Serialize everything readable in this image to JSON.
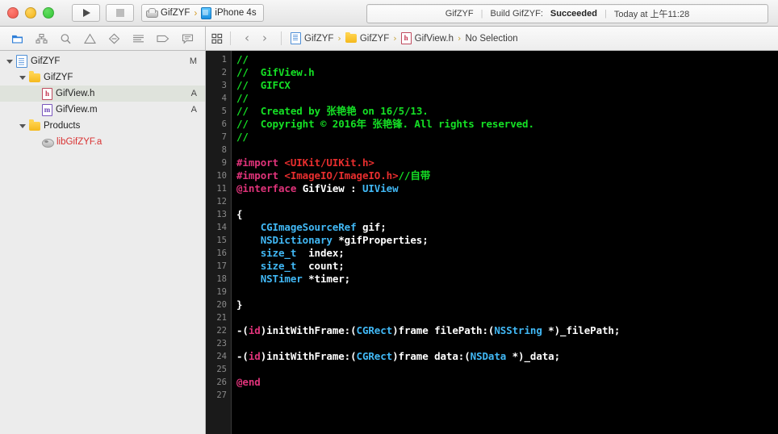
{
  "window": {
    "traffic_lights": [
      "close",
      "minimize",
      "zoom"
    ]
  },
  "toolbar": {
    "run_label": "Run",
    "stop_label": "Stop",
    "scheme": {
      "target": "GifZYF",
      "separator": "›",
      "destination": "iPhone 4s"
    },
    "status": {
      "project": "GifZYF",
      "pipe": "|",
      "action": "Build GifZYF:",
      "result": "Succeeded",
      "time": "Today at 上午11:28"
    }
  },
  "navigator_filter": {
    "icons": [
      {
        "name": "folder-icon",
        "label": "Project navigator",
        "active": true
      },
      {
        "name": "hierarchy-icon",
        "label": "Source control navigator",
        "active": false
      },
      {
        "name": "search-icon",
        "label": "Find navigator",
        "active": false
      },
      {
        "name": "warning-triangle-icon",
        "label": "Issue navigator",
        "active": false
      },
      {
        "name": "diamond-icon",
        "label": "Test navigator",
        "active": false
      },
      {
        "name": "list-lines-icon",
        "label": "Debug navigator",
        "active": false
      },
      {
        "name": "tag-icon",
        "label": "Breakpoint navigator",
        "active": false
      },
      {
        "name": "speech-bubble-icon",
        "label": "Report navigator",
        "active": false
      }
    ]
  },
  "breadcrumb": {
    "grid_icon": "grid-icon",
    "back": "‹",
    "forward": "›",
    "items": [
      {
        "label": "GifZYF",
        "icon": "project-doc-icon"
      },
      {
        "label": "GifZYF",
        "icon": "folder-icon"
      },
      {
        "label": "GifView.h",
        "icon": "header-file-icon"
      },
      {
        "label": "No Selection",
        "icon": null
      }
    ],
    "chevron": "›"
  },
  "sidebar": {
    "tree": [
      {
        "label": "GifZYF",
        "icon": "project-icon",
        "indent": 0,
        "disclosure": "open",
        "status": "M",
        "selected": false,
        "red": false
      },
      {
        "label": "GifZYF",
        "icon": "folder-icon",
        "indent": 1,
        "disclosure": "open",
        "status": "",
        "selected": false,
        "red": false
      },
      {
        "label": "GifView.h",
        "icon": "header-file-icon",
        "indent": 2,
        "disclosure": "none",
        "status": "A",
        "selected": true,
        "red": false
      },
      {
        "label": "GifView.m",
        "icon": "source-file-icon",
        "indent": 2,
        "disclosure": "none",
        "status": "A",
        "selected": false,
        "red": false
      },
      {
        "label": "Products",
        "icon": "folder-icon",
        "indent": 1,
        "disclosure": "open",
        "status": "",
        "selected": false,
        "red": false
      },
      {
        "label": "libGifZYF.a",
        "icon": "library-icon",
        "indent": 2,
        "disclosure": "none",
        "status": "",
        "selected": false,
        "red": true
      }
    ]
  },
  "editor": {
    "first_line": 1,
    "last_line": 27,
    "line_numbers": [
      1,
      2,
      3,
      4,
      5,
      6,
      7,
      8,
      9,
      10,
      11,
      12,
      13,
      14,
      15,
      16,
      17,
      18,
      19,
      20,
      21,
      22,
      23,
      24,
      25,
      26,
      27
    ],
    "lines": [
      {
        "n": 1,
        "tokens": [
          {
            "t": "//",
            "c": "cmt"
          }
        ]
      },
      {
        "n": 2,
        "tokens": [
          {
            "t": "//  GifView.h",
            "c": "cmt"
          }
        ]
      },
      {
        "n": 3,
        "tokens": [
          {
            "t": "//  GIFCX",
            "c": "cmt"
          }
        ]
      },
      {
        "n": 4,
        "tokens": [
          {
            "t": "//",
            "c": "cmt"
          }
        ]
      },
      {
        "n": 5,
        "tokens": [
          {
            "t": "//  Created by 张艳艳 on 16/5/13.",
            "c": "cmt"
          }
        ]
      },
      {
        "n": 6,
        "tokens": [
          {
            "t": "//  Copyright © 2016年 张艳锋. All rights reserved.",
            "c": "cmt"
          }
        ]
      },
      {
        "n": 7,
        "tokens": [
          {
            "t": "//",
            "c": "cmt"
          }
        ]
      },
      {
        "n": 8,
        "tokens": []
      },
      {
        "n": 9,
        "tokens": [
          {
            "t": "#import ",
            "c": "pre"
          },
          {
            "t": "<UIKit/UIKit.h>",
            "c": "str"
          }
        ]
      },
      {
        "n": 10,
        "tokens": [
          {
            "t": "#import ",
            "c": "pre"
          },
          {
            "t": "<ImageIO/ImageIO.h>",
            "c": "str"
          },
          {
            "t": "//自带",
            "c": "cmt"
          }
        ]
      },
      {
        "n": 11,
        "tokens": [
          {
            "t": "@interface",
            "c": "kw"
          },
          {
            "t": " GifView : ",
            "c": "pln"
          },
          {
            "t": "UIView",
            "c": "type"
          }
        ]
      },
      {
        "n": 12,
        "tokens": []
      },
      {
        "n": 13,
        "tokens": [
          {
            "t": "{",
            "c": "pln"
          }
        ]
      },
      {
        "n": 14,
        "tokens": [
          {
            "t": "    ",
            "c": "pln"
          },
          {
            "t": "CGImageSourceRef",
            "c": "type"
          },
          {
            "t": " gif;",
            "c": "pln"
          }
        ]
      },
      {
        "n": 15,
        "tokens": [
          {
            "t": "    ",
            "c": "pln"
          },
          {
            "t": "NSDictionary",
            "c": "type"
          },
          {
            "t": " *gifProperties;",
            "c": "pln"
          }
        ]
      },
      {
        "n": 16,
        "tokens": [
          {
            "t": "    ",
            "c": "pln"
          },
          {
            "t": "size_t",
            "c": "type"
          },
          {
            "t": "  index;",
            "c": "pln"
          }
        ]
      },
      {
        "n": 17,
        "tokens": [
          {
            "t": "    ",
            "c": "pln"
          },
          {
            "t": "size_t",
            "c": "type"
          },
          {
            "t": "  count;",
            "c": "pln"
          }
        ]
      },
      {
        "n": 18,
        "tokens": [
          {
            "t": "    ",
            "c": "pln"
          },
          {
            "t": "NSTimer",
            "c": "type"
          },
          {
            "t": " *timer;",
            "c": "pln"
          }
        ]
      },
      {
        "n": 19,
        "tokens": []
      },
      {
        "n": 20,
        "tokens": [
          {
            "t": "}",
            "c": "pln"
          }
        ]
      },
      {
        "n": 21,
        "tokens": []
      },
      {
        "n": 22,
        "tokens": [
          {
            "t": "-(",
            "c": "pln"
          },
          {
            "t": "id",
            "c": "kw"
          },
          {
            "t": ")initWithFrame:(",
            "c": "pln"
          },
          {
            "t": "CGRect",
            "c": "type"
          },
          {
            "t": ")frame filePath:(",
            "c": "pln"
          },
          {
            "t": "NSString",
            "c": "type"
          },
          {
            "t": " *)_filePath;",
            "c": "pln"
          }
        ]
      },
      {
        "n": 23,
        "tokens": []
      },
      {
        "n": 24,
        "tokens": [
          {
            "t": "-(",
            "c": "pln"
          },
          {
            "t": "id",
            "c": "kw"
          },
          {
            "t": ")initWithFrame:(",
            "c": "pln"
          },
          {
            "t": "CGRect",
            "c": "type"
          },
          {
            "t": ")frame data:(",
            "c": "pln"
          },
          {
            "t": "NSData",
            "c": "type"
          },
          {
            "t": " *)_data;",
            "c": "pln"
          }
        ]
      },
      {
        "n": 25,
        "tokens": []
      },
      {
        "n": 26,
        "tokens": [
          {
            "t": "@end",
            "c": "kw"
          }
        ]
      },
      {
        "n": 27,
        "tokens": []
      }
    ]
  },
  "colors": {
    "editor_background": "#000000",
    "gutter_background": "#1a1a1a",
    "comment": "#15e025",
    "preprocessor": "#e0337a",
    "string": "#e82e2e",
    "keyword": "#e0337a",
    "type": "#41b8f5",
    "plain": "#ffffff",
    "sidebar_background": "#ececec",
    "selection": "#dfe3dc",
    "library_red": "#d93232"
  }
}
